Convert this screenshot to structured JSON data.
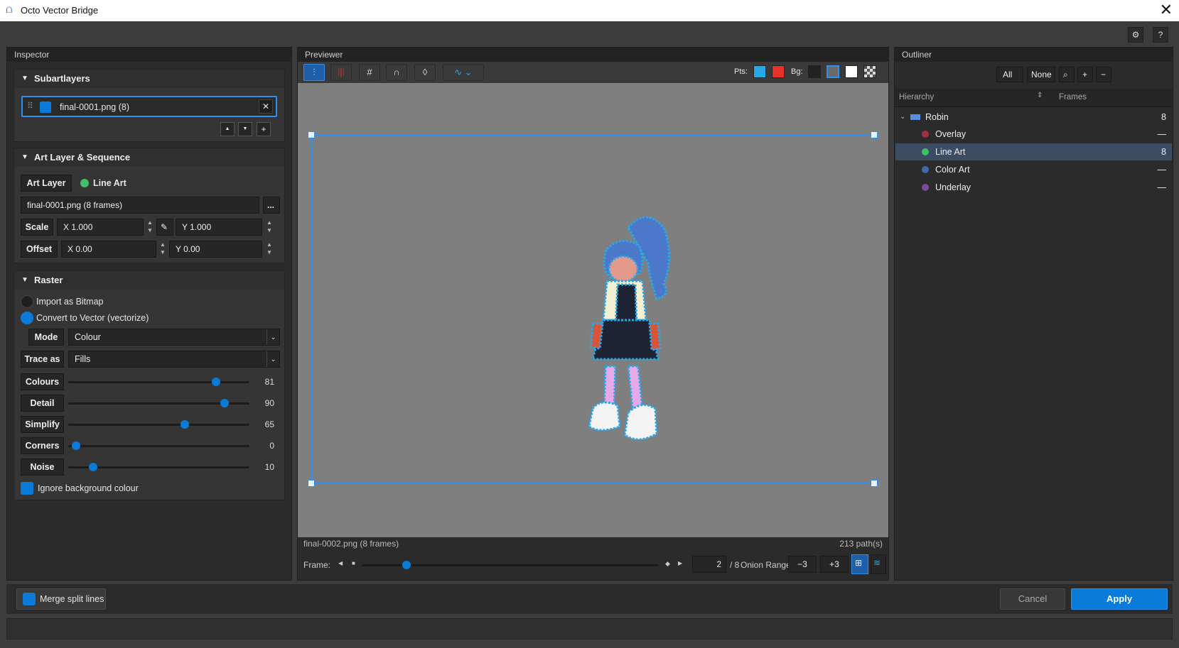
{
  "window": {
    "title": "Octo Vector Bridge"
  },
  "top_icons": {
    "settings": "gear-icon",
    "help": "?"
  },
  "inspector": {
    "title": "Inspector",
    "subartlayers": {
      "title": "Subartlayers",
      "item": {
        "label": "final-0001.png  (8)",
        "color": "#0a7bd8"
      },
      "buttons": {
        "up": "▲",
        "down": "▼",
        "add": "+"
      }
    },
    "art_layer": {
      "title": "Art Layer & Sequence",
      "art_layer_label": "Art Layer",
      "art_layer_value": "Line Art",
      "file": "final-0001.png  (8 frames)",
      "browse": "...",
      "scale_label": "Scale",
      "scale_x": "X 1.000",
      "scale_y": "Y 1.000",
      "offset_label": "Offset",
      "offset_x": "X 0.00",
      "offset_y": "Y 0.00"
    },
    "raster": {
      "title": "Raster",
      "import_bitmap": "Import as Bitmap",
      "convert_vector": "Convert to Vector (vectorize)",
      "mode_label": "Mode",
      "mode_value": "Colour",
      "trace_label": "Trace as",
      "trace_value": "Fills",
      "sliders": [
        {
          "label": "Colours",
          "value": "81",
          "level": 0.83
        },
        {
          "label": "Detail",
          "value": "90",
          "level": 0.88
        },
        {
          "label": "Simplify",
          "value": "65",
          "level": 0.65
        },
        {
          "label": "Corners",
          "value": "0",
          "level": 0.02
        },
        {
          "label": "Noise",
          "value": "10",
          "level": 0.12
        }
      ],
      "ignore_bg": "Ignore background colour"
    }
  },
  "previewer": {
    "title": "Previewer",
    "pts_label": "Pts:",
    "bg_label": "Bg:",
    "pts_colors": [
      "#29a8e8",
      "#e8312a"
    ],
    "bg_colors": [
      "#222222",
      "#6a6a6a",
      "#ffffff",
      "checker",
      "#777777"
    ],
    "file_info": "final-0002.png  (8 frames)",
    "paths": "213 path(s)",
    "frame_label": "Frame:",
    "frame_value": "2",
    "frame_total": "/ 8",
    "frame_level": 0.14,
    "onion_label": "Onion Range",
    "onion_minus": "−3",
    "onion_plus": "+3"
  },
  "outliner": {
    "title": "Outliner",
    "btn_all": "All",
    "btn_none": "None",
    "col_hierarchy": "Hierarchy",
    "col_frames": "Frames",
    "root": {
      "label": "Robin",
      "frames": "8"
    },
    "items": [
      {
        "label": "Overlay",
        "frames": "—",
        "color": "#a03040"
      },
      {
        "label": "Line Art",
        "frames": "8",
        "color": "#3fbf6a"
      },
      {
        "label": "Color Art",
        "frames": "—",
        "color": "#3b6ea8"
      },
      {
        "label": "Underlay",
        "frames": "—",
        "color": "#7a4a9a"
      }
    ]
  },
  "footer": {
    "merge": "Merge split lines",
    "cancel": "Cancel",
    "apply": "Apply"
  }
}
